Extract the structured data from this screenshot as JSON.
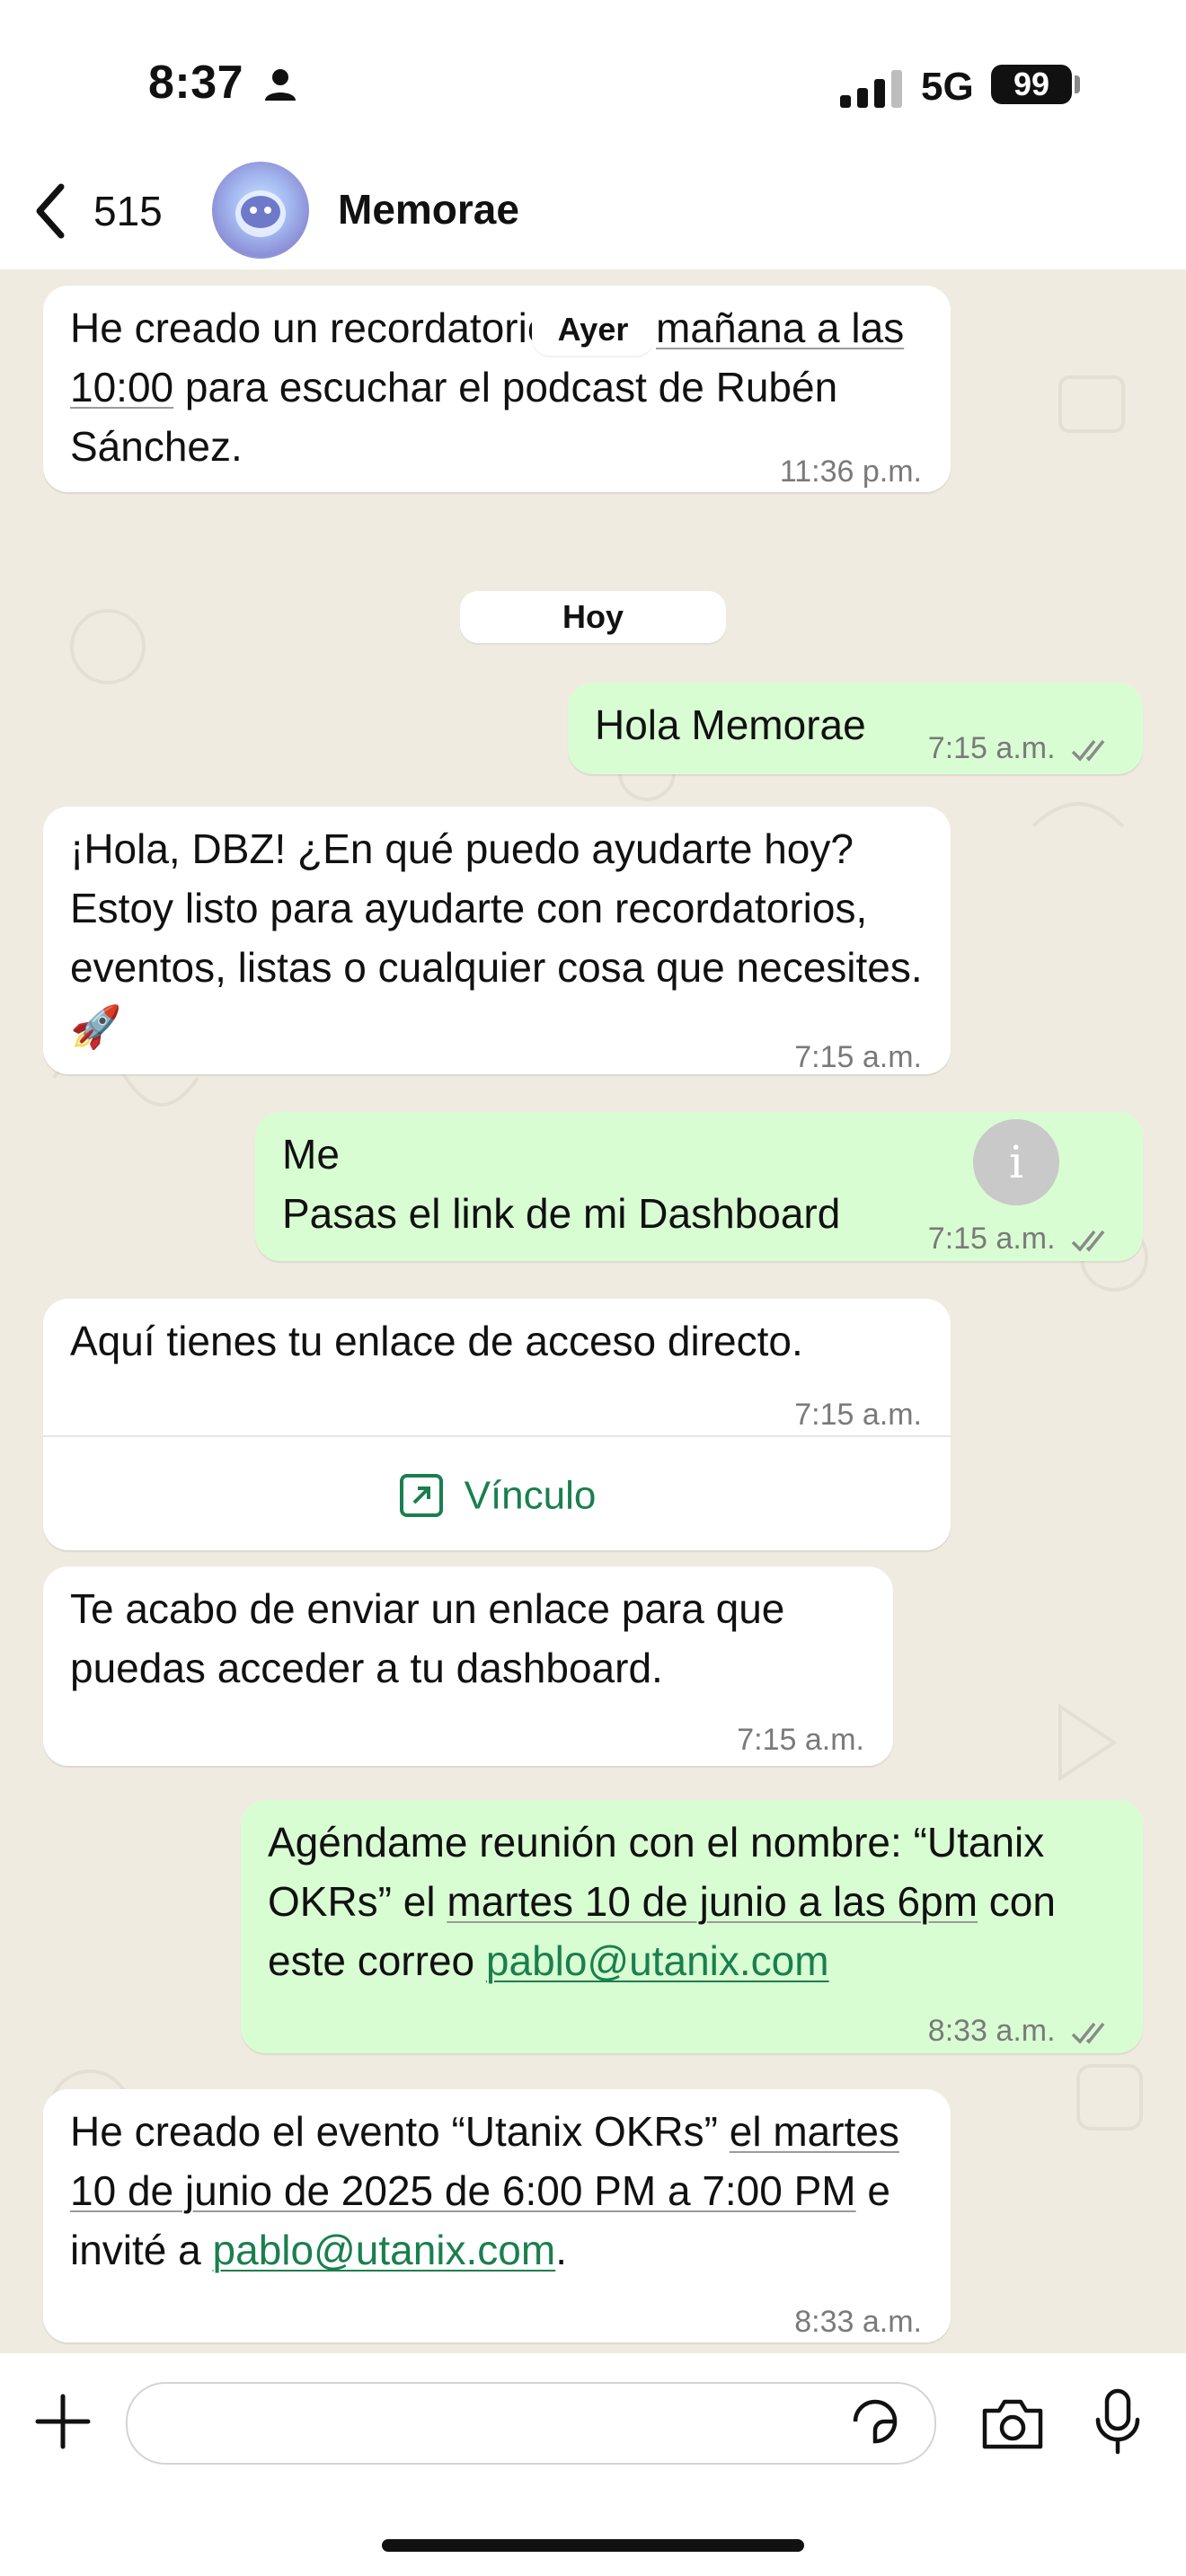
{
  "status_bar": {
    "time": "8:37",
    "network": "5G",
    "battery": "99"
  },
  "header": {
    "back_count": "515",
    "contact_name": "Memorae"
  },
  "chat": {
    "day_labels": {
      "yesterday": "Ayer",
      "today": "Hoy"
    },
    "messages": [
      {
        "direction": "in",
        "text": "He creado un recordatorio para mañana a las 10:00 para escuchar el podcast de Rubén Sánchez.",
        "time": "11:36 p.m."
      },
      {
        "direction": "out",
        "text": "Hola Memorae",
        "time": "7:15 a.m.",
        "status": "read"
      },
      {
        "direction": "in",
        "text": "¡Hola, DBZ! ¿En qué puedo ayudarte hoy? Estoy listo para ayudarte con recordatorios, eventos, listas o cualquier cosa que necesites. 🚀",
        "time": "7:15 a.m."
      },
      {
        "direction": "out",
        "text": "Me\nPasas el link de mi Dashboard",
        "time": "7:15 a.m.",
        "status": "read"
      },
      {
        "direction": "in",
        "text": "Aquí tienes tu enlace de acceso directo.",
        "time": "7:15 a.m.",
        "button": "Vínculo"
      },
      {
        "direction": "in",
        "text": "Te acabo de enviar un enlace para que puedas acceder a tu dashboard.",
        "time": "7:15 a.m."
      },
      {
        "direction": "out",
        "text": "Agéndame reunión con el nombre: “Utanix OKRs” el martes 10 de junio a las 6pm con este correo pablo@utanix.com",
        "time": "8:33 a.m.",
        "status": "read"
      },
      {
        "direction": "in",
        "text": "He creado el evento “Utanix OKRs” el martes 10 de junio de 2025 de 6:00 PM a 7:00 PM e invité a pablo@utanix.com.",
        "time": "8:33 a.m."
      }
    ]
  },
  "colors": {
    "incoming": "#ffffff",
    "outgoing": "#d9fdd3",
    "link": "#1a7f4e",
    "wallpaper": "#f0ebe1"
  }
}
